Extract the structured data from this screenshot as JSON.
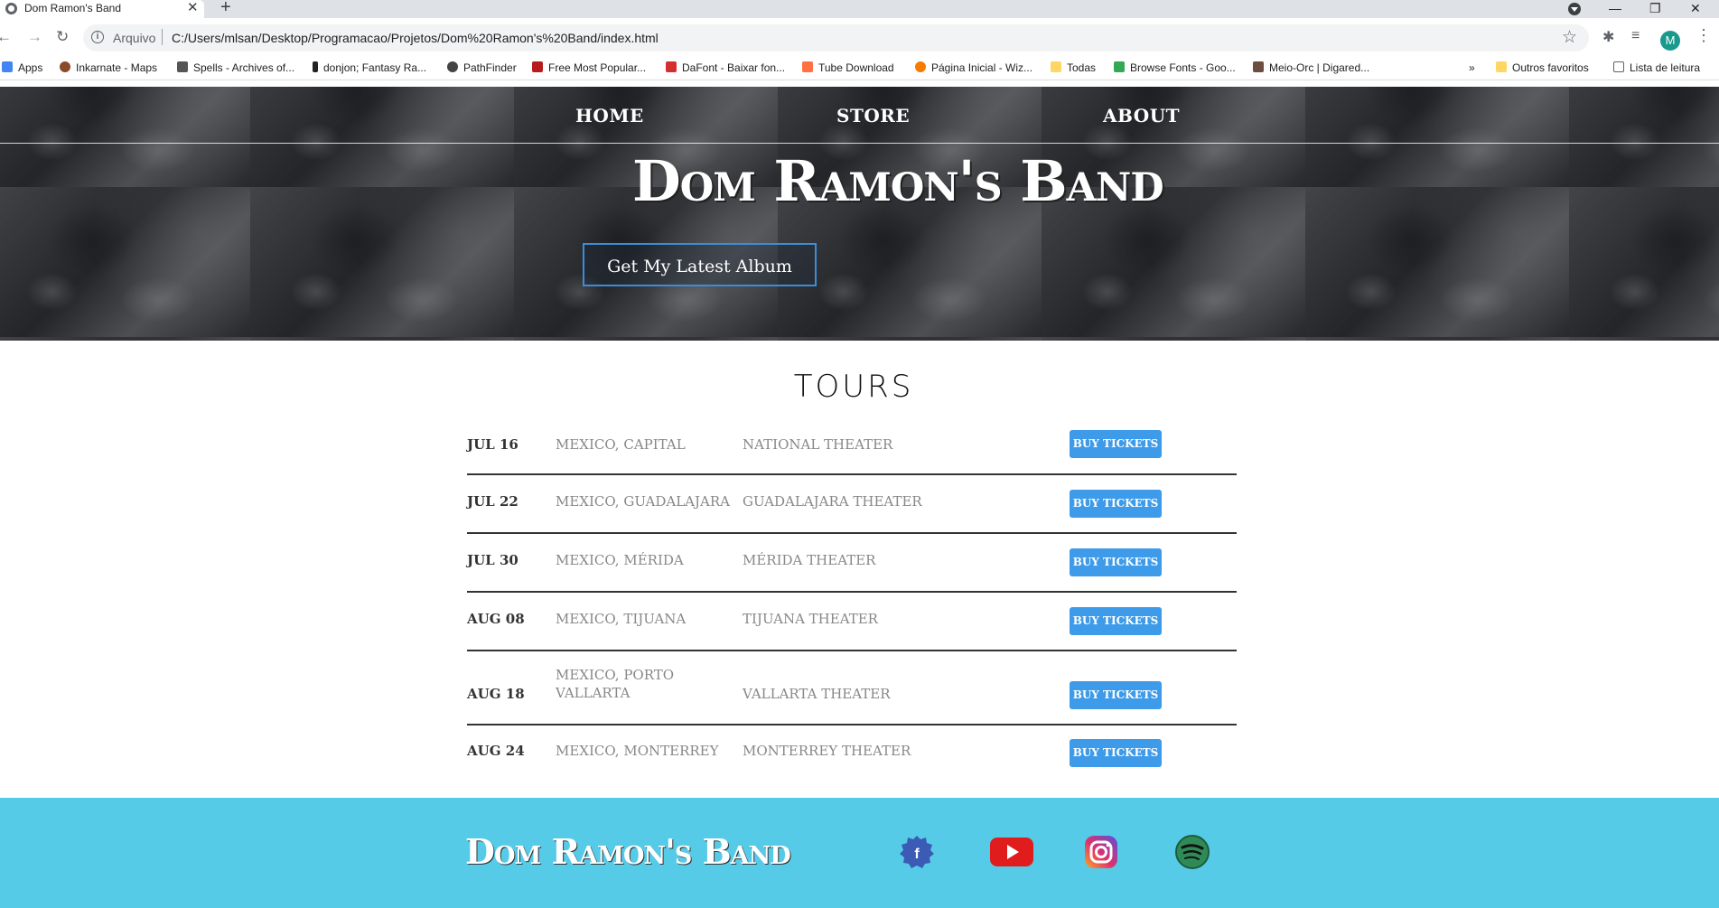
{
  "browser": {
    "tab_title": "Dom Ramon's Band",
    "scheme_label": "Arquivo",
    "url": "C:/Users/mlsan/Desktop/Programacao/Projetos/Dom%20Ramon's%20Band/index.html",
    "profile_initial": "M",
    "bookmarks": [
      {
        "label": "Apps",
        "color": "#4285f4"
      },
      {
        "label": "Inkarnate - Maps",
        "color": "#8a4b2a"
      },
      {
        "label": "Spells - Archives of...",
        "color": "#555555"
      },
      {
        "label": "donjon; Fantasy Ra...",
        "color": "#222222"
      },
      {
        "label": "PathFinder",
        "color": "#444444"
      },
      {
        "label": "Free Most Popular...",
        "color": "#b71c1c"
      },
      {
        "label": "DaFont - Baixar fon...",
        "color": "#d32f2f"
      },
      {
        "label": "Tube Download",
        "color": "#ff7043"
      },
      {
        "label": "Página Inicial - Wiz...",
        "color": "#f57c00"
      },
      {
        "label": "Todas",
        "color": "#fdd663"
      },
      {
        "label": "Browse Fonts - Goo...",
        "color": "#34a853"
      },
      {
        "label": "Meio-Orc | Digared...",
        "color": "#6d4c41"
      }
    ],
    "bookmarks_overflow": "»",
    "other_favorites": "Outros favoritos",
    "reading_list": "Lista de leitura"
  },
  "nav": {
    "home": "HOME",
    "store": "STORE",
    "about": "ABOUT"
  },
  "hero": {
    "title": "Dom Ramon's Band",
    "album_button": "Get My Latest Album"
  },
  "tours": {
    "heading": "TOURS",
    "rows": [
      {
        "date": "JUL 16",
        "city": "MEXICO, CAPITAL",
        "venue": "NATIONAL THEATER",
        "button": "BUY TICKETS"
      },
      {
        "date": "JUL 22",
        "city": "MEXICO, GUADALAJARA",
        "venue": "GUADALAJARA THEATER",
        "button": "BUY TICKETS"
      },
      {
        "date": "JUL 30",
        "city": "MEXICO, MÉRIDA",
        "venue": "MÉRIDA THEATER",
        "button": "BUY TICKETS"
      },
      {
        "date": "AUG 08",
        "city": "MEXICO, TIJUANA",
        "venue": "TIJUANA THEATER",
        "button": "BUY TICKETS"
      },
      {
        "date": "AUG 18",
        "city": "MEXICO, PORTO VALLARTA",
        "venue": "VALLARTA THEATER",
        "button": "BUY TICKETS"
      },
      {
        "date": "AUG 24",
        "city": "MEXICO, MONTERREY",
        "venue": "MONTERREY THEATER",
        "button": "BUY TICKETS"
      }
    ]
  },
  "footer": {
    "logo": "Dom Ramon's Band",
    "social": [
      "facebook-icon",
      "youtube-icon",
      "instagram-icon",
      "spotify-icon"
    ]
  },
  "colors": {
    "accent_blue": "#3d9be9",
    "footer_bg": "#56cbe8",
    "divider": "#333333"
  }
}
